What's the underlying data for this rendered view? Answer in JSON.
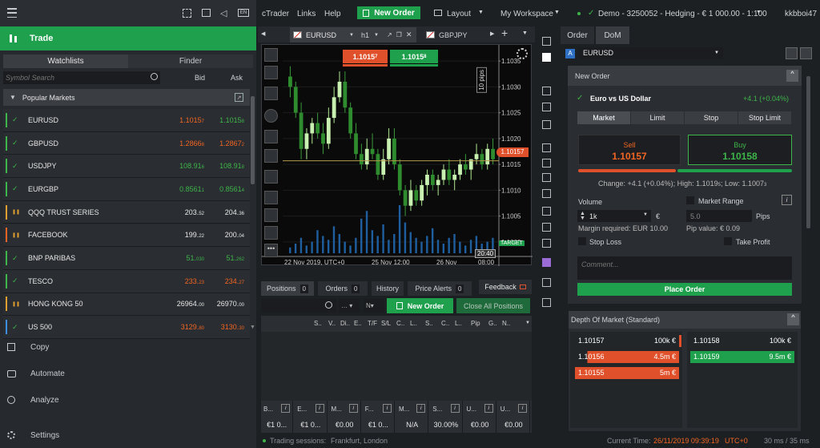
{
  "left": {
    "icons": [
      "menu-icon",
      "focus-icon",
      "window-icon",
      "sound-icon",
      "lang-icon"
    ],
    "lang": "EN",
    "trade_label": "Trade",
    "tab_watchlists": "Watchlists",
    "tab_finder": "Finder",
    "search_placeholder": "Symbol Search",
    "col_bid": "Bid",
    "col_ask": "Ask",
    "group": "Popular Markets",
    "rows": [
      {
        "sym": "EURUSD",
        "bid": "1.1015",
        "bidsup": "7",
        "ask": "1.1015",
        "asksup": "8",
        "bidc": "#f26522",
        "askc": "#3db54a",
        "bar": "#3db54a",
        "open": true
      },
      {
        "sym": "GBPUSD",
        "bid": "1.2866",
        "bidsup": "8",
        "ask": "1.2867",
        "asksup": "2",
        "bidc": "#f26522",
        "askc": "#f26522",
        "bar": "#3db54a",
        "open": true
      },
      {
        "sym": "USDJPY",
        "bid": "108.91",
        "bidsup": "6",
        "ask": "108.91",
        "asksup": "8",
        "bidc": "#3db54a",
        "askc": "#3db54a",
        "bar": "#3db54a",
        "open": true
      },
      {
        "sym": "EURGBP",
        "bid": "0.8561",
        "bidsup": "1",
        "ask": "0.8561",
        "asksup": "4",
        "bidc": "#3db54a",
        "askc": "#3db54a",
        "bar": "#3db54a",
        "open": true
      },
      {
        "sym": "QQQ TRUST SERIES",
        "bid": "203.",
        "bidsup": "52",
        "ask": "204.",
        "asksup": "36",
        "bidc": "#e6e6e6",
        "askc": "#e6e6e6",
        "bar": "#e0a030",
        "open": false
      },
      {
        "sym": "FACEBOOK",
        "bid": "199.",
        "bidsup": "22",
        "ask": "200.",
        "asksup": "04",
        "bidc": "#e6e6e6",
        "askc": "#e6e6e6",
        "bar": "#f26522",
        "open": false
      },
      {
        "sym": "BNP PARIBAS",
        "bid": "51.",
        "bidsup": "030",
        "ask": "51.",
        "asksup": "262",
        "bidc": "#3db54a",
        "askc": "#3db54a",
        "bar": "#3db54a",
        "open": true
      },
      {
        "sym": "TESCO",
        "bid": "233.",
        "bidsup": "23",
        "ask": "234.",
        "asksup": "27",
        "bidc": "#f26522",
        "askc": "#f26522",
        "bar": "#3db54a",
        "open": true
      },
      {
        "sym": "HONG KONG 50",
        "bid": "26964.",
        "bidsup": "00",
        "ask": "26970.",
        "asksup": "00",
        "bidc": "#e6e6e6",
        "askc": "#e6e6e6",
        "bar": "#e0a030",
        "open": false
      },
      {
        "sym": "US 500",
        "bid": "3129.",
        "bidsup": "80",
        "ask": "3130.",
        "asksup": "30",
        "bidc": "#f26522",
        "askc": "#f26522",
        "bar": "#3d8de0",
        "open": true
      }
    ],
    "nav": [
      "Copy",
      "Automate",
      "Analyze",
      "Settings"
    ]
  },
  "top": {
    "menu": [
      "cTrader",
      "Links",
      "Help"
    ],
    "new_order": "New Order",
    "layout": "Layout",
    "workspace": "My Workspace",
    "account": "Demo - 3250052 - Hedging - € 1 000.00 - 1:100",
    "user": "kkbboi47"
  },
  "chart": {
    "tab1": "EURUSD",
    "tf": "h1",
    "tab2": "GBPJPY",
    "sell": "1.1015",
    "sellsup": "7",
    "buy": "1.1015",
    "buysup": "8",
    "pips": "10 pips",
    "price_tag": "1.10157",
    "target": "TARGET",
    "time_label": "20:40",
    "chart_data": {
      "type": "candlestick",
      "yticks": [
        "1.1035",
        "1.1030",
        "1.1025",
        "1.1020",
        "1.1015",
        "1.1010",
        "1.1005",
        "1.1000"
      ],
      "ylim": [
        1.09978,
        1.10372
      ],
      "xticks": [
        "22 Nov 2019, UTC+0",
        "25 Nov 12:00",
        "26 Nov",
        "08:00"
      ],
      "candles": [
        [
          1.1032,
          1.1034,
          1.1028,
          1.103
        ],
        [
          1.103,
          1.1031,
          1.1024,
          1.1025
        ],
        [
          1.1025,
          1.1027,
          1.1016,
          1.1018
        ],
        [
          1.1018,
          1.1022,
          1.1016,
          1.1021
        ],
        [
          1.1021,
          1.1024,
          1.1019,
          1.1023
        ],
        [
          1.1023,
          1.1025,
          1.102,
          1.1021
        ],
        [
          1.1021,
          1.1023,
          1.1017,
          1.1019
        ],
        [
          1.1019,
          1.1026,
          1.1018,
          1.1024
        ],
        [
          1.1024,
          1.103,
          1.1023,
          1.1028
        ],
        [
          1.1028,
          1.1033,
          1.1027,
          1.1031
        ],
        [
          1.1031,
          1.1033,
          1.1025,
          1.1026
        ],
        [
          1.1026,
          1.1027,
          1.102,
          1.1021
        ],
        [
          1.1021,
          1.1023,
          1.1016,
          1.1017
        ],
        [
          1.1017,
          1.1019,
          1.1014,
          1.1015
        ],
        [
          1.1015,
          1.102,
          1.1014,
          1.1018
        ],
        [
          1.1018,
          1.1021,
          1.1016,
          1.1017
        ],
        [
          1.1017,
          1.1018,
          1.1012,
          1.1013
        ],
        [
          1.1013,
          1.1018,
          1.1012,
          1.1016
        ],
        [
          1.1016,
          1.1022,
          1.1015,
          1.102
        ],
        [
          1.102,
          1.1022,
          1.1014,
          1.1015
        ],
        [
          1.1015,
          1.1016,
          1.1009,
          1.101
        ],
        [
          1.101,
          1.1011,
          1.1005,
          1.1007
        ],
        [
          1.1007,
          1.1012,
          1.1006,
          1.101
        ],
        [
          1.101,
          1.1011,
          1.1007,
          1.1008
        ],
        [
          1.1008,
          1.1012,
          1.1007,
          1.1011
        ],
        [
          1.1011,
          1.1014,
          1.1009,
          1.1013
        ],
        [
          1.1013,
          1.1014,
          1.101,
          1.1011
        ],
        [
          1.1011,
          1.1013,
          1.1009,
          1.1012
        ],
        [
          1.1012,
          1.1015,
          1.1011,
          1.1014
        ],
        [
          1.1014,
          1.1016,
          1.1011,
          1.1012
        ],
        [
          1.1012,
          1.1014,
          1.101,
          1.1013
        ],
        [
          1.1013,
          1.1016,
          1.1012,
          1.1015
        ],
        [
          1.1015,
          1.1017,
          1.1013,
          1.1014
        ],
        [
          1.1014,
          1.1016,
          1.1012,
          1.1016
        ],
        [
          1.1016,
          1.1019,
          1.1015,
          1.1017
        ],
        [
          1.1017,
          1.1018,
          1.1014,
          1.1015
        ],
        [
          1.1015,
          1.1019,
          1.1014,
          1.1018
        ],
        [
          1.1018,
          1.102,
          1.1015,
          1.1016
        ]
      ],
      "volume": [
        3,
        5,
        8,
        4,
        6,
        12,
        9,
        7,
        14,
        10,
        6,
        4,
        8,
        18,
        22,
        12,
        9,
        15,
        7,
        10,
        25,
        16,
        11,
        8,
        6,
        9,
        13,
        7,
        5,
        8,
        10,
        6,
        4,
        7,
        9,
        5,
        6,
        8
      ]
    }
  },
  "positions": {
    "tabs": [
      {
        "l": "Positions",
        "n": "0"
      },
      {
        "l": "Orders",
        "n": "0"
      },
      {
        "l": "History",
        "n": ""
      },
      {
        "l": "Price Alerts",
        "n": "0"
      }
    ],
    "feedback": "Feedback",
    "new_order": "New Order",
    "close_all": "Close All Positions",
    "cols": [
      "S..",
      "V..",
      "Di..",
      "E..",
      "T/F",
      "S/L",
      "C..",
      "L..",
      "S..",
      "C..",
      "L..",
      "Pip",
      "G..",
      "N.."
    ],
    "foot_labels": [
      "B...",
      "E...",
      "M...",
      "F...",
      "M...",
      "S...",
      "U...",
      "U..."
    ],
    "foot_values": [
      "€1 0...",
      "€1 0...",
      "€0.00",
      "€1 0...",
      "N/A",
      "30.00%",
      "€0.00",
      "€0.00"
    ]
  },
  "status": {
    "sessions": "Trading sessions:",
    "markets": "Frankfurt, London",
    "time_label": "Current Time:",
    "time": "26/11/2019 09:39:19",
    "tz": "UTC+0",
    "latency": "30 ms / 35 ms"
  },
  "order": {
    "tab_order": "Order",
    "tab_dom": "DoM",
    "symbol": "EURUSD",
    "title": "New Order",
    "name": "Euro vs US Dollar",
    "change": "+4.1 (+0.04%)",
    "types": [
      "Market",
      "Limit",
      "Stop",
      "Stop Limit"
    ],
    "sell": "Sell",
    "sell_price": "1.10157",
    "buy": "Buy",
    "buy_price": "1.10158",
    "stats": "Change: +4.1 (+0.04%); High: 1.1019",
    "stats_hs": "5",
    "stats_low": "; Low: 1.1007",
    "stats_ls": "3",
    "volume_label": "Volume",
    "volume": "1k",
    "currency": "€",
    "range_label": "Market Range",
    "range": "5.0",
    "pips": "Pips",
    "margin": "Margin required: EUR 10.00",
    "pip_value": "Pip value: € 0.09",
    "stop_loss": "Stop Loss",
    "take_profit": "Take Profit",
    "comment_placeholder": "Comment...",
    "place": "Place Order"
  },
  "dom": {
    "title": "Depth Of Market (Standard)",
    "asks": [
      {
        "p": "1.10157",
        "v": "100k €"
      },
      {
        "p": "1.10156",
        "v": "4.5m €"
      },
      {
        "p": "1.10155",
        "v": "5m €"
      }
    ],
    "bids": [
      {
        "p": "1.10158",
        "v": "100k €"
      },
      {
        "p": "1.10159",
        "v": "9.5m €"
      }
    ]
  }
}
